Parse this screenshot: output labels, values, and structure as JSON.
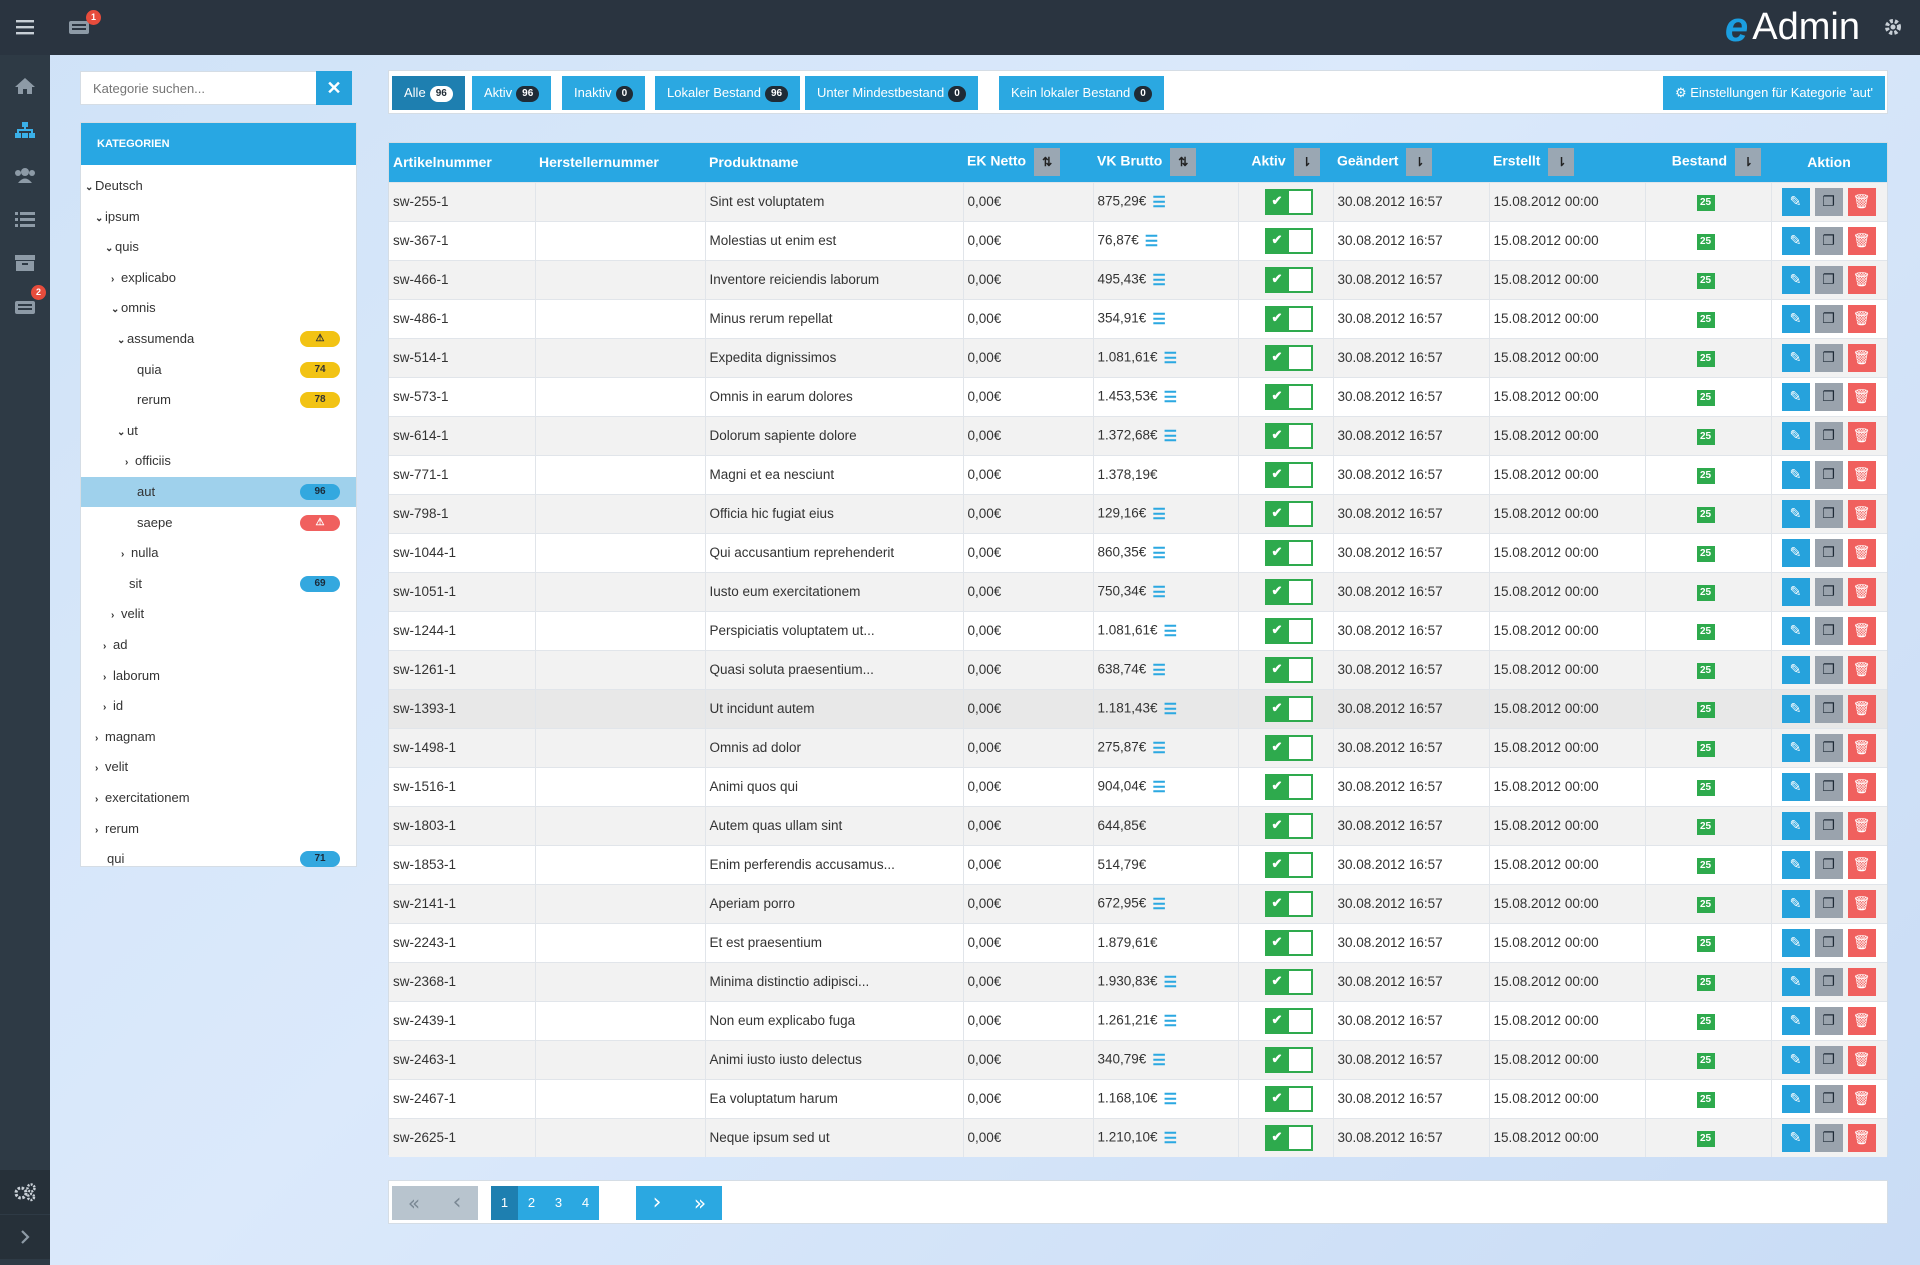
{
  "topbar": {
    "menu_icon": "hamburger-icon",
    "inbox_badge": "1",
    "brand_text": "Admin",
    "brand_mark": "e",
    "settings_icon": "gear-icon"
  },
  "sidebar": {
    "items": [
      {
        "icon": "home-icon"
      },
      {
        "icon": "sitemap-icon"
      },
      {
        "icon": "users-icon"
      },
      {
        "icon": "list-icon"
      },
      {
        "icon": "archive-icon"
      },
      {
        "icon": "inbox-icon",
        "badge": "2"
      }
    ],
    "bottom_icon": "cogs-icon",
    "expand_icon": "chevron-right-icon"
  },
  "search": {
    "placeholder": "Kategorie suchen...",
    "clear_label": "✕"
  },
  "tree": {
    "header": "KATEGORIEN",
    "nodes": [
      {
        "label": "Deutsch",
        "caret": "⌄"
      },
      {
        "label": "ipsum",
        "caret": "⌄"
      },
      {
        "label": "quis",
        "caret": "⌄"
      },
      {
        "label": "explicabo",
        "caret": "›"
      },
      {
        "label": "omnis",
        "caret": "⌄"
      },
      {
        "label": "assumenda",
        "caret": "⌄",
        "badge": "⚠"
      },
      {
        "label": "quia",
        "caret": "",
        "badge": "74"
      },
      {
        "label": "rerum",
        "caret": "",
        "badge": "78"
      },
      {
        "label": "ut",
        "caret": "⌄"
      },
      {
        "label": "officiis",
        "caret": "›"
      },
      {
        "label": "aut",
        "caret": "",
        "badge": "96"
      },
      {
        "label": "saepe",
        "caret": "",
        "badge": "⚠"
      },
      {
        "label": "nulla",
        "caret": "›"
      },
      {
        "label": "sit",
        "caret": "",
        "badge": "69"
      },
      {
        "label": "velit",
        "caret": "›"
      },
      {
        "label": "ad",
        "caret": "›"
      },
      {
        "label": "laborum",
        "caret": "›"
      },
      {
        "label": "id",
        "caret": "›"
      },
      {
        "label": "magnam",
        "caret": "›"
      },
      {
        "label": "velit",
        "caret": "›"
      },
      {
        "label": "exercitationem",
        "caret": "›"
      },
      {
        "label": "rerum",
        "caret": "›"
      },
      {
        "label": "qui",
        "caret": "",
        "badge": "71"
      }
    ]
  },
  "filters": [
    {
      "label": "Alle",
      "count": "96"
    },
    {
      "label": "Aktiv",
      "count": "96"
    },
    {
      "label": "Inaktiv",
      "count": "0"
    },
    {
      "label": "Lokaler Bestand",
      "count": "96"
    },
    {
      "label": "Unter Mindestbestand",
      "count": "0"
    },
    {
      "label": "Kein lokaler Bestand",
      "count": "0"
    }
  ],
  "settings_button": "Einstellungen für Kategorie 'aut'",
  "table": {
    "columns": [
      "Artikelnummer",
      "Herstellernummer",
      "Produktname",
      "EK Netto",
      "VK Brutto",
      "Aktiv",
      "Geändert",
      "Erstellt",
      "Bestand",
      "Aktion"
    ],
    "sort_icons": {
      "ek": "⇅",
      "vk": "⇅",
      "aktiv": "⇂",
      "geaendert": "⇂",
      "erstellt": "⇂",
      "bestand": "⇂"
    },
    "rows": [
      {
        "nr": "sw-255-1",
        "name": "Sint est voluptatem",
        "ek": "0,00€",
        "vk": "875,29€",
        "list": "☰",
        "changed": "30.08.2012 16:57",
        "created": "15.08.2012 00:00",
        "stock": "25"
      },
      {
        "nr": "sw-367-1",
        "name": "Molestias ut enim est",
        "ek": "0,00€",
        "vk": "76,87€",
        "list": "☰",
        "changed": "30.08.2012 16:57",
        "created": "15.08.2012 00:00",
        "stock": "25"
      },
      {
        "nr": "sw-466-1",
        "name": "Inventore reiciendis laborum",
        "ek": "0,00€",
        "vk": "495,43€",
        "list": "☰",
        "changed": "30.08.2012 16:57",
        "created": "15.08.2012 00:00",
        "stock": "25"
      },
      {
        "nr": "sw-486-1",
        "name": "Minus rerum repellat",
        "ek": "0,00€",
        "vk": "354,91€",
        "list": "☰",
        "changed": "30.08.2012 16:57",
        "created": "15.08.2012 00:00",
        "stock": "25"
      },
      {
        "nr": "sw-514-1",
        "name": "Expedita dignissimos",
        "ek": "0,00€",
        "vk": "1.081,61€",
        "list": "☰",
        "changed": "30.08.2012 16:57",
        "created": "15.08.2012 00:00",
        "stock": "25"
      },
      {
        "nr": "sw-573-1",
        "name": "Omnis in earum dolores",
        "ek": "0,00€",
        "vk": "1.453,53€",
        "list": "☰",
        "changed": "30.08.2012 16:57",
        "created": "15.08.2012 00:00",
        "stock": "25"
      },
      {
        "nr": "sw-614-1",
        "name": "Dolorum sapiente dolore",
        "ek": "0,00€",
        "vk": "1.372,68€",
        "list": "☰",
        "changed": "30.08.2012 16:57",
        "created": "15.08.2012 00:00",
        "stock": "25"
      },
      {
        "nr": "sw-771-1",
        "name": "Magni et ea nesciunt",
        "ek": "0,00€",
        "vk": "1.378,19€",
        "list": "",
        "changed": "30.08.2012 16:57",
        "created": "15.08.2012 00:00",
        "stock": "25"
      },
      {
        "nr": "sw-798-1",
        "name": "Officia hic fugiat eius",
        "ek": "0,00€",
        "vk": "129,16€",
        "list": "☰",
        "changed": "30.08.2012 16:57",
        "created": "15.08.2012 00:00",
        "stock": "25"
      },
      {
        "nr": "sw-1044-1",
        "name": "Qui accusantium reprehenderit",
        "ek": "0,00€",
        "vk": "860,35€",
        "list": "☰",
        "changed": "30.08.2012 16:57",
        "created": "15.08.2012 00:00",
        "stock": "25"
      },
      {
        "nr": "sw-1051-1",
        "name": "Iusto eum exercitationem",
        "ek": "0,00€",
        "vk": "750,34€",
        "list": "☰",
        "changed": "30.08.2012 16:57",
        "created": "15.08.2012 00:00",
        "stock": "25"
      },
      {
        "nr": "sw-1244-1",
        "name": "Perspiciatis voluptatem ut...",
        "ek": "0,00€",
        "vk": "1.081,61€",
        "list": "☰",
        "changed": "30.08.2012 16:57",
        "created": "15.08.2012 00:00",
        "stock": "25"
      },
      {
        "nr": "sw-1261-1",
        "name": "Quasi soluta praesentium...",
        "ek": "0,00€",
        "vk": "638,74€",
        "list": "☰",
        "changed": "30.08.2012 16:57",
        "created": "15.08.2012 00:00",
        "stock": "25"
      },
      {
        "nr": "sw-1393-1",
        "name": "Ut incidunt autem",
        "ek": "0,00€",
        "vk": "1.181,43€",
        "list": "☰",
        "changed": "30.08.2012 16:57",
        "created": "15.08.2012 00:00",
        "stock": "25"
      },
      {
        "nr": "sw-1498-1",
        "name": "Omnis ad dolor",
        "ek": "0,00€",
        "vk": "275,87€",
        "list": "☰",
        "changed": "30.08.2012 16:57",
        "created": "15.08.2012 00:00",
        "stock": "25"
      },
      {
        "nr": "sw-1516-1",
        "name": "Animi quos qui",
        "ek": "0,00€",
        "vk": "904,04€",
        "list": "☰",
        "changed": "30.08.2012 16:57",
        "created": "15.08.2012 00:00",
        "stock": "25"
      },
      {
        "nr": "sw-1803-1",
        "name": "Autem quas ullam sint",
        "ek": "0,00€",
        "vk": "644,85€",
        "list": "",
        "changed": "30.08.2012 16:57",
        "created": "15.08.2012 00:00",
        "stock": "25"
      },
      {
        "nr": "sw-1853-1",
        "name": "Enim perferendis accusamus...",
        "ek": "0,00€",
        "vk": "514,79€",
        "list": "",
        "changed": "30.08.2012 16:57",
        "created": "15.08.2012 00:00",
        "stock": "25"
      },
      {
        "nr": "sw-2141-1",
        "name": "Aperiam porro",
        "ek": "0,00€",
        "vk": "672,95€",
        "list": "☰",
        "changed": "30.08.2012 16:57",
        "created": "15.08.2012 00:00",
        "stock": "25"
      },
      {
        "nr": "sw-2243-1",
        "name": "Et est praesentium",
        "ek": "0,00€",
        "vk": "1.879,61€",
        "list": "",
        "changed": "30.08.2012 16:57",
        "created": "15.08.2012 00:00",
        "stock": "25"
      },
      {
        "nr": "sw-2368-1",
        "name": "Minima distinctio adipisci...",
        "ek": "0,00€",
        "vk": "1.930,83€",
        "list": "☰",
        "changed": "30.08.2012 16:57",
        "created": "15.08.2012 00:00",
        "stock": "25"
      },
      {
        "nr": "sw-2439-1",
        "name": "Non eum explicabo fuga",
        "ek": "0,00€",
        "vk": "1.261,21€",
        "list": "☰",
        "changed": "30.08.2012 16:57",
        "created": "15.08.2012 00:00",
        "stock": "25"
      },
      {
        "nr": "sw-2463-1",
        "name": "Animi iusto iusto delectus",
        "ek": "0,00€",
        "vk": "340,79€",
        "list": "☰",
        "changed": "30.08.2012 16:57",
        "created": "15.08.2012 00:00",
        "stock": "25"
      },
      {
        "nr": "sw-2467-1",
        "name": "Ea voluptatum harum",
        "ek": "0,00€",
        "vk": "1.168,10€",
        "list": "☰",
        "changed": "30.08.2012 16:57",
        "created": "15.08.2012 00:00",
        "stock": "25"
      },
      {
        "nr": "sw-2625-1",
        "name": "Neque ipsum sed ut",
        "ek": "0,00€",
        "vk": "1.210,10€",
        "list": "☰",
        "changed": "30.08.2012 16:57",
        "created": "15.08.2012 00:00",
        "stock": "25"
      }
    ]
  },
  "pagination": {
    "first": "«",
    "prev": "‹",
    "pages": [
      "1",
      "2",
      "3",
      "4"
    ],
    "current": "1",
    "next": "›",
    "last": "»"
  },
  "colors": {
    "accent": "#28a7e3",
    "dark_nav": "#2a3440",
    "active_green": "#2eaa4d",
    "danger": "#f0605e",
    "warning": "#f2c314"
  }
}
